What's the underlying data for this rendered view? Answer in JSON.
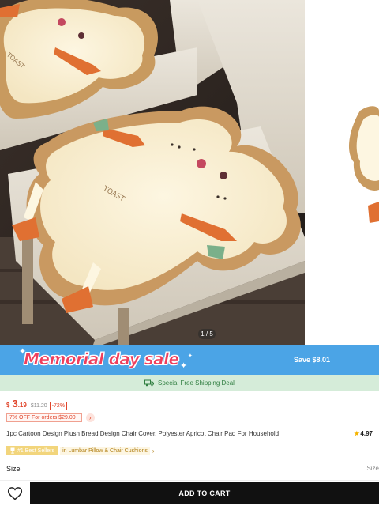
{
  "gallery": {
    "counter": "1 / 5",
    "image_subject": "plush bread toast chair cushion"
  },
  "sale_banner": {
    "title": "Memorial day sale",
    "save_text": "Save $8.01",
    "title_color": "#ef3e5c",
    "background_color": "#4ba4e6"
  },
  "shipping": {
    "text": "Special Free Shipping Deal",
    "icon": "truck-icon"
  },
  "price": {
    "currency": "$",
    "integer": "3",
    "decimal": ".19",
    "original": "$11.20",
    "discount": "-72%",
    "color": "#e0452b"
  },
  "promo": {
    "text": "7% OFF For orders $29.00+",
    "arrow": "›"
  },
  "product": {
    "title": "1pc Cartoon Design Plush Bread Design Chair Cover, Polyester Apricot Chair Pad For Household",
    "rating": "4.97"
  },
  "bestseller": {
    "badge": "#1 Best Sellers",
    "category": "in Lumbar Pillow & Chair Cushions",
    "arrow": "›"
  },
  "size": {
    "label": "Size",
    "guide": "Size"
  },
  "bottom_bar": {
    "cart_label": "ADD TO CART",
    "wishlist_icon": "heart-icon"
  }
}
